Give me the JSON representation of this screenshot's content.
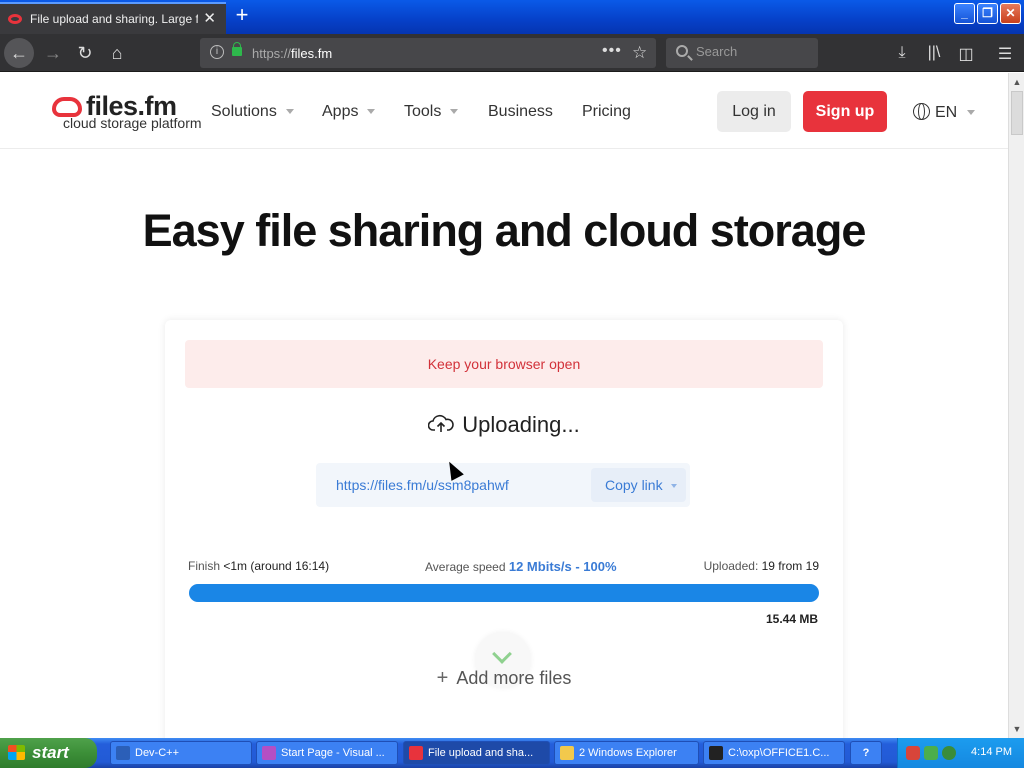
{
  "browser": {
    "tab_title": "File upload and sharing. Large file",
    "tab_close": "✕",
    "new_tab": "+",
    "url_scheme": "https://",
    "url_host": "files.fm",
    "search_placeholder": "Search",
    "window_buttons": {
      "minimize": "_",
      "restore": "❐",
      "close": "✕"
    }
  },
  "site": {
    "logo_name": "files.fm",
    "logo_tagline": "cloud storage platform",
    "nav": [
      {
        "label": "Solutions",
        "dropdown": true
      },
      {
        "label": "Apps",
        "dropdown": true
      },
      {
        "label": "Tools",
        "dropdown": true
      },
      {
        "label": "Business",
        "dropdown": false
      },
      {
        "label": "Pricing",
        "dropdown": false
      }
    ],
    "login": "Log in",
    "signup": "Sign up",
    "language": "EN",
    "brand_color": "#e8333c"
  },
  "hero": {
    "title": "Easy file sharing and cloud storage"
  },
  "upload": {
    "alert": "Keep your browser open",
    "status": "Uploading...",
    "share_link": "https://files.fm/u/ssm8pahwf",
    "copy_link": "Copy link",
    "finish_label": "Finish",
    "finish_value": "<1m (around 16:14)",
    "speed_label": "Average speed",
    "speed_value": "12 Mbits/s - 100%",
    "uploaded_label": "Uploaded:",
    "uploaded_value": "19 from 19",
    "progress_fraction": 1.0,
    "total_size": "15.44 MB",
    "add_more": "Add more files",
    "add_more_plus": "+"
  },
  "taskbar": {
    "start": "start",
    "tasks": [
      {
        "label": "Dev-C++",
        "icon_color": "#2b5fb8"
      },
      {
        "label": "Start Page - Visual ...",
        "icon_color": "#b44fc4"
      },
      {
        "label": "File upload and sha...",
        "icon_color": "#e8333c"
      },
      {
        "label": "2 Windows Explorer",
        "icon_color": "#f2c94c"
      },
      {
        "label": "C:\\oxp\\OFFICE1.C...",
        "icon_color": "#222222"
      }
    ],
    "help": "?",
    "clock": "4:14 PM"
  }
}
